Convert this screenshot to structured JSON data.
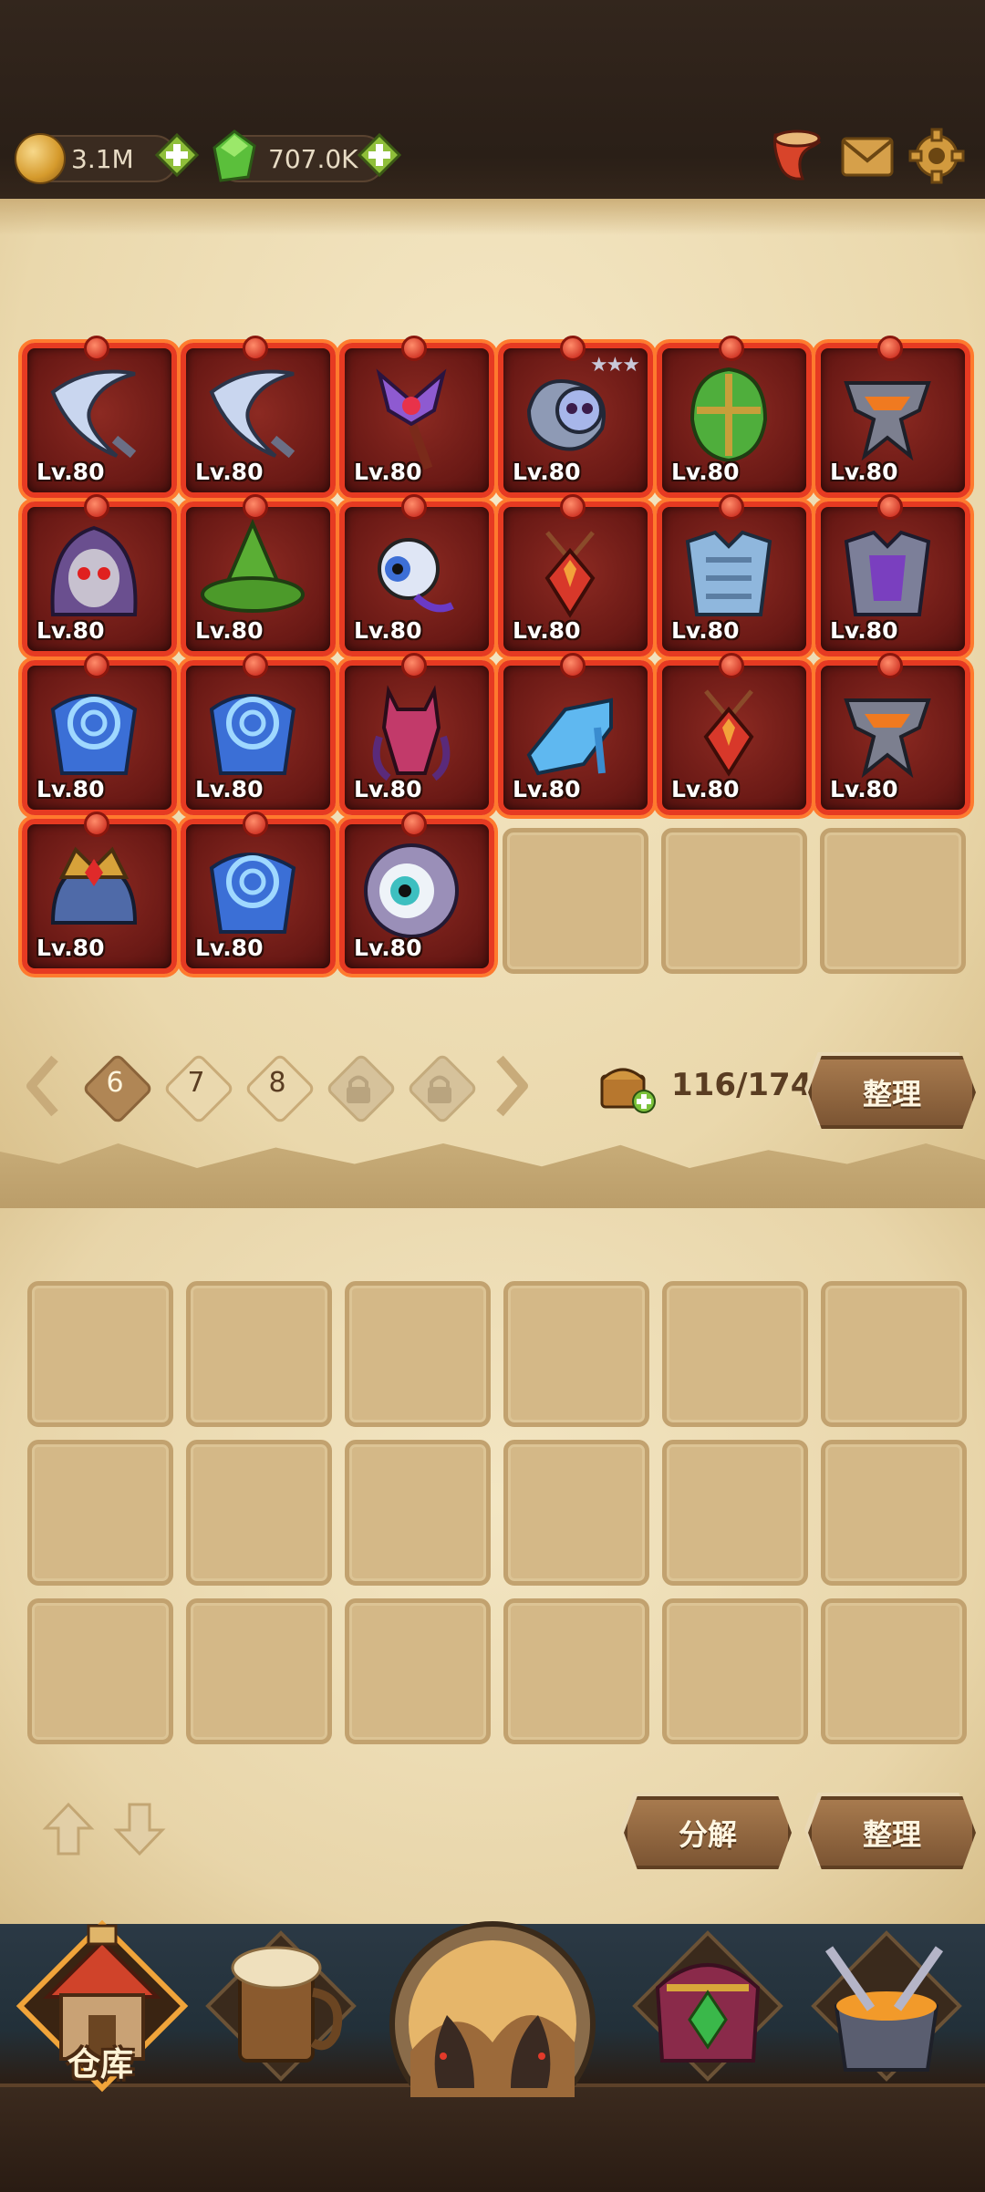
{
  "currencies": {
    "gold": "3.1M",
    "gems": "707.0K"
  },
  "inventory": {
    "items": [
      {
        "name": "curved-blade",
        "level": "Lv.80"
      },
      {
        "name": "curved-blade",
        "level": "Lv.80"
      },
      {
        "name": "purple-helm-staff",
        "level": "Lv.80"
      },
      {
        "name": "skull-shoulder",
        "level": "Lv.80"
      },
      {
        "name": "green-shell-armor",
        "level": "Lv.80"
      },
      {
        "name": "flame-mask",
        "level": "Lv.80"
      },
      {
        "name": "hooded-skull",
        "level": "Lv.80"
      },
      {
        "name": "wizard-hat",
        "level": "Lv.80"
      },
      {
        "name": "eyeball-staff",
        "level": "Lv.80"
      },
      {
        "name": "red-pendant",
        "level": "Lv.80"
      },
      {
        "name": "blue-chest-armor",
        "level": "Lv.80"
      },
      {
        "name": "purple-chest-armor",
        "level": "Lv.80"
      },
      {
        "name": "swirl-gauntlet",
        "level": "Lv.80"
      },
      {
        "name": "swirl-gauntlet",
        "level": "Lv.80"
      },
      {
        "name": "demon-figure",
        "level": "Lv.80"
      },
      {
        "name": "glass-slipper",
        "level": "Lv.80"
      },
      {
        "name": "red-pendant",
        "level": "Lv.80"
      },
      {
        "name": "flame-mask",
        "level": "Lv.80"
      },
      {
        "name": "crowned-helm",
        "level": "Lv.80"
      },
      {
        "name": "swirl-gauntlet",
        "level": "Lv.80"
      },
      {
        "name": "eye-orb",
        "level": "Lv.80"
      }
    ],
    "pages": [
      "6",
      "7",
      "8"
    ],
    "active_page": "6",
    "capacity": "116/174",
    "sort_label": "整理"
  },
  "lower_panel": {
    "decompose_label": "分解",
    "sort_label": "整理"
  },
  "nav": {
    "warehouse_label": "仓库"
  }
}
